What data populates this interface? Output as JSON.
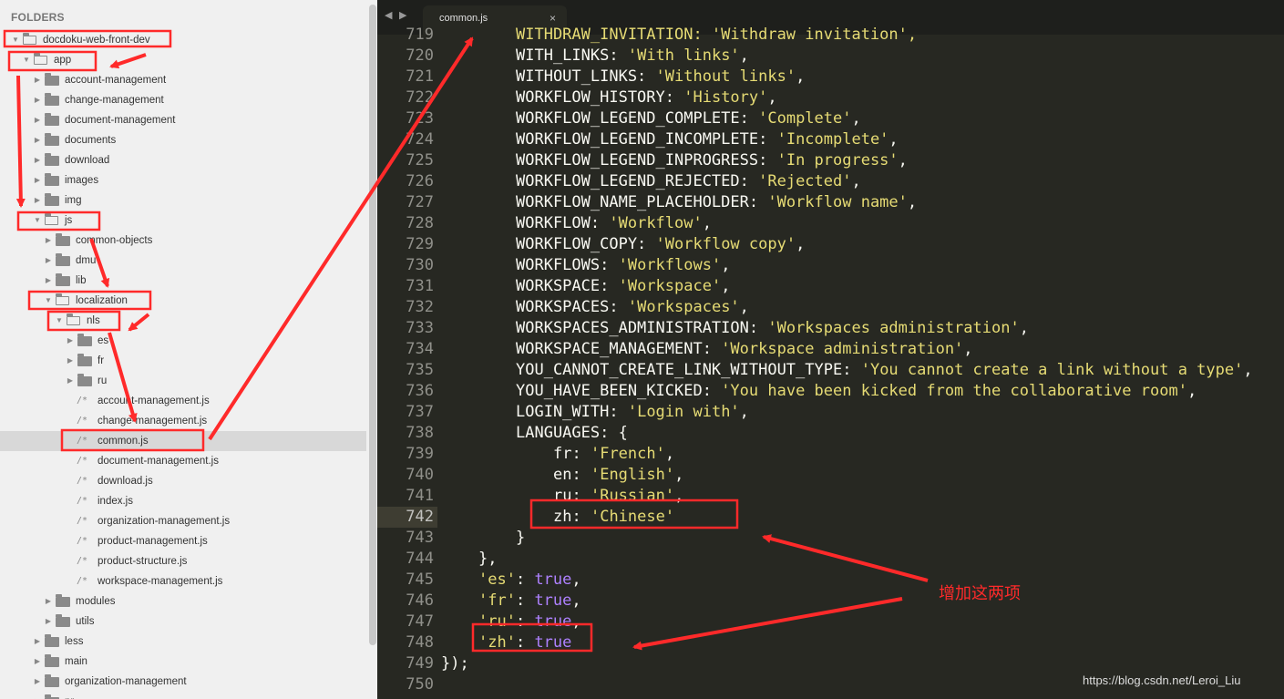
{
  "sidebar": {
    "title": "FOLDERS",
    "items": [
      {
        "label": "docdoku-web-front-dev",
        "type": "folder",
        "open": true,
        "level": 0
      },
      {
        "label": "app",
        "type": "folder",
        "open": true,
        "level": 1
      },
      {
        "label": "account-management",
        "type": "folder",
        "open": false,
        "level": 2
      },
      {
        "label": "change-management",
        "type": "folder",
        "open": false,
        "level": 2
      },
      {
        "label": "document-management",
        "type": "folder",
        "open": false,
        "level": 2
      },
      {
        "label": "documents",
        "type": "folder",
        "open": false,
        "level": 2
      },
      {
        "label": "download",
        "type": "folder",
        "open": false,
        "level": 2
      },
      {
        "label": "images",
        "type": "folder",
        "open": false,
        "level": 2
      },
      {
        "label": "img",
        "type": "folder",
        "open": false,
        "level": 2
      },
      {
        "label": "js",
        "type": "folder",
        "open": true,
        "level": 2
      },
      {
        "label": "common-objects",
        "type": "folder",
        "open": false,
        "level": 3
      },
      {
        "label": "dmu",
        "type": "folder",
        "open": false,
        "level": 3
      },
      {
        "label": "lib",
        "type": "folder",
        "open": false,
        "level": 3
      },
      {
        "label": "localization",
        "type": "folder",
        "open": true,
        "level": 3
      },
      {
        "label": "nls",
        "type": "folder",
        "open": true,
        "level": 4
      },
      {
        "label": "es",
        "type": "folder",
        "open": false,
        "level": 5
      },
      {
        "label": "fr",
        "type": "folder",
        "open": false,
        "level": 5
      },
      {
        "label": "ru",
        "type": "folder",
        "open": false,
        "level": 5
      },
      {
        "label": "account-management.js",
        "type": "file",
        "level": 5
      },
      {
        "label": "change-management.js",
        "type": "file",
        "level": 5
      },
      {
        "label": "common.js",
        "type": "file",
        "level": 5,
        "selected": true
      },
      {
        "label": "document-management.js",
        "type": "file",
        "level": 5
      },
      {
        "label": "download.js",
        "type": "file",
        "level": 5
      },
      {
        "label": "index.js",
        "type": "file",
        "level": 5
      },
      {
        "label": "organization-management.js",
        "type": "file",
        "level": 5
      },
      {
        "label": "product-management.js",
        "type": "file",
        "level": 5
      },
      {
        "label": "product-structure.js",
        "type": "file",
        "level": 5
      },
      {
        "label": "workspace-management.js",
        "type": "file",
        "level": 5
      },
      {
        "label": "modules",
        "type": "folder",
        "open": false,
        "level": 3
      },
      {
        "label": "utils",
        "type": "folder",
        "open": false,
        "level": 3
      },
      {
        "label": "less",
        "type": "folder",
        "open": false,
        "level": 2
      },
      {
        "label": "main",
        "type": "folder",
        "open": false,
        "level": 2
      },
      {
        "label": "organization-management",
        "type": "folder",
        "open": false,
        "level": 2
      },
      {
        "label": "pr...",
        "type": "folder",
        "open": false,
        "level": 2
      }
    ],
    "file_icon": "/*"
  },
  "tabbar": {
    "back_icon": "◀",
    "forward_icon": "▶",
    "tab_label": "common.js",
    "close_icon": "×"
  },
  "editor": {
    "first_line_partial": "WITHDRAW_INVITATION: 'Withdraw invitation',",
    "first_line_number": "719",
    "current_line": "742",
    "lines": [
      {
        "n": "720",
        "ind": 2,
        "key": "WITH_LINKS",
        "val": "'With links'",
        "tail": ","
      },
      {
        "n": "721",
        "ind": 2,
        "key": "WITHOUT_LINKS",
        "val": "'Without links'",
        "tail": ","
      },
      {
        "n": "722",
        "ind": 2,
        "key": "WORKFLOW_HISTORY",
        "val": "'History'",
        "tail": ","
      },
      {
        "n": "723",
        "ind": 2,
        "key": "WORKFLOW_LEGEND_COMPLETE",
        "val": "'Complete'",
        "tail": ","
      },
      {
        "n": "724",
        "ind": 2,
        "key": "WORKFLOW_LEGEND_INCOMPLETE",
        "val": "'Incomplete'",
        "tail": ","
      },
      {
        "n": "725",
        "ind": 2,
        "key": "WORKFLOW_LEGEND_INPROGRESS",
        "val": "'In progress'",
        "tail": ","
      },
      {
        "n": "726",
        "ind": 2,
        "key": "WORKFLOW_LEGEND_REJECTED",
        "val": "'Rejected'",
        "tail": ","
      },
      {
        "n": "727",
        "ind": 2,
        "key": "WORKFLOW_NAME_PLACEHOLDER",
        "val": "'Workflow name'",
        "tail": ","
      },
      {
        "n": "728",
        "ind": 2,
        "key": "WORKFLOW",
        "val": "'Workflow'",
        "tail": ","
      },
      {
        "n": "729",
        "ind": 2,
        "key": "WORKFLOW_COPY",
        "val": "'Workflow copy'",
        "tail": ","
      },
      {
        "n": "730",
        "ind": 2,
        "key": "WORKFLOWS",
        "val": "'Workflows'",
        "tail": ","
      },
      {
        "n": "731",
        "ind": 2,
        "key": "WORKSPACE",
        "val": "'Workspace'",
        "tail": ","
      },
      {
        "n": "732",
        "ind": 2,
        "key": "WORKSPACES",
        "val": "'Workspaces'",
        "tail": ","
      },
      {
        "n": "733",
        "ind": 2,
        "key": "WORKSPACES_ADMINISTRATION",
        "val": "'Workspaces administration'",
        "tail": ","
      },
      {
        "n": "734",
        "ind": 2,
        "key": "WORKSPACE_MANAGEMENT",
        "val": "'Workspace administration'",
        "tail": ","
      },
      {
        "n": "735",
        "ind": 2,
        "key": "YOU_CANNOT_CREATE_LINK_WITHOUT_TYPE",
        "val": "'You cannot create a link without a type'",
        "tail": ","
      },
      {
        "n": "736",
        "ind": 2,
        "key": "YOU_HAVE_BEEN_KICKED",
        "val": "'You have been kicked from the collaborative room'",
        "tail": ","
      },
      {
        "n": "737",
        "ind": 2,
        "key": "LOGIN_WITH",
        "val": "'Login with'",
        "tail": ","
      },
      {
        "n": "738",
        "ind": 2,
        "key": "LANGUAGES",
        "val": "",
        "tail": " {"
      },
      {
        "n": "739",
        "ind": 3,
        "key": "fr",
        "val": "'French'",
        "tail": ","
      },
      {
        "n": "740",
        "ind": 3,
        "key": "en",
        "val": "'English'",
        "tail": ","
      },
      {
        "n": "741",
        "ind": 3,
        "key": "ru",
        "val": "'Russian'",
        "tail": ","
      },
      {
        "n": "742",
        "ind": 3,
        "key": "zh",
        "val": "'Chinese'",
        "tail": ""
      },
      {
        "n": "743",
        "ind": 2,
        "raw": "}"
      },
      {
        "n": "744",
        "ind": 1,
        "raw": "},"
      },
      {
        "n": "745",
        "ind": 1,
        "skey": "'es'",
        "tval": "true",
        "tail": ","
      },
      {
        "n": "746",
        "ind": 1,
        "skey": "'fr'",
        "tval": "true",
        "tail": ","
      },
      {
        "n": "747",
        "ind": 1,
        "skey": "'ru'",
        "tval": "true",
        "tail": ","
      },
      {
        "n": "748",
        "ind": 1,
        "skey": "'zh'",
        "tval": "true",
        "tail": ""
      },
      {
        "n": "749",
        "ind": 0,
        "raw": "});"
      },
      {
        "n": "750",
        "ind": 0,
        "raw": ""
      }
    ]
  },
  "annotation": {
    "text": "增加这两项",
    "color": "#ff2a2a"
  },
  "watermark": "https://blog.csdn.net/Leroi_Liu",
  "colors": {
    "editor_bg": "#272822",
    "string": "#e6db74",
    "boolean": "#ae81ff",
    "text": "#f8f8f2",
    "gutter": "#90908a",
    "sidebar_bg": "#f0f0f0"
  }
}
